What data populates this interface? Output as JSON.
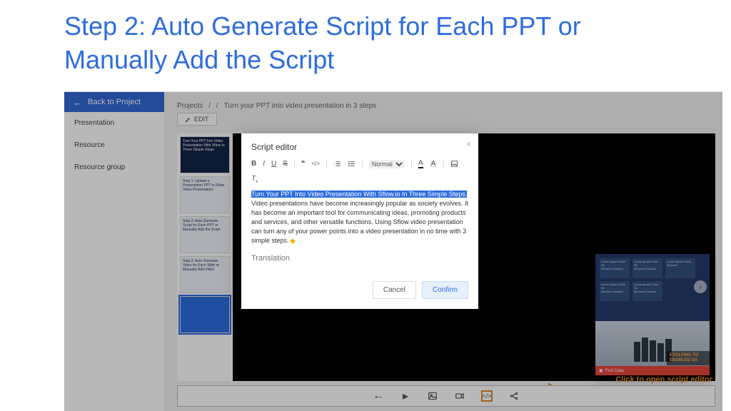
{
  "page_title": "Step 2: Auto Generate Script for Each PPT or Manually Add the Script",
  "back_label": "Back to Project",
  "sidebar": {
    "items": [
      {
        "label": "Presentation"
      },
      {
        "label": "Resource"
      },
      {
        "label": "Resource group"
      }
    ]
  },
  "breadcrumb": {
    "root": "Projects",
    "sep": "/",
    "current": "Turn your PPT into video presentation in 3 steps"
  },
  "edit_label": "EDIT",
  "thumbs": [
    {
      "title": "Turn Your PPT Into Video Presentation With Sflow In Three Simple Steps"
    },
    {
      "title": "Step 1: Upload a Presentation PPT to Sflow Video Presentation"
    },
    {
      "title": "Step 2: Auto Generate Script for Each PPT or Manually Add the Script"
    },
    {
      "title": "Step 3: Auto Generate Video for Each Slide or Manually Add Video"
    },
    {
      "title": ""
    }
  ],
  "preview": {
    "card_line1": "Lorem Ipsum Dolor Sit",
    "card_line2": "Sit Amet Consect",
    "card_line3": "Lorem Ipsum Dolor Sit Amet",
    "overlay_line1": "EVOLVING TO",
    "overlay_line2": "ENABLED SA",
    "brand": "First Data"
  },
  "toolbar_icons": [
    "arrow-left",
    "play",
    "image",
    "camera",
    "code",
    "share"
  ],
  "callout": "Click to open script editor",
  "modal": {
    "title": "Script editor",
    "size_label": "Normal",
    "highlight": "Turn Your PPT Into Video Presentation With Sflow.io In Three Simple Steps.",
    "body": " Video presentations have become increasingly popular as society evolves. It has become an important tool for communicating ideas, promoting products and services, and other versatile functions. Using Sflow video presentation can turn any of your power points into a video presentation in no time with 3 simple steps.",
    "translation": "Translation",
    "cancel": "Cancel",
    "confirm": "Confirm"
  }
}
